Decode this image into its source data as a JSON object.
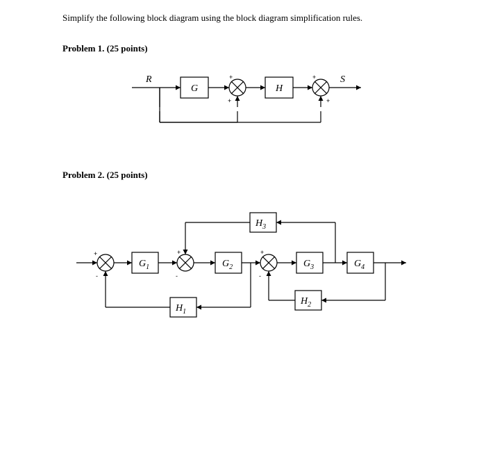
{
  "intro": "Simplify the following block diagram using the block diagram simplification rules.",
  "problem1": {
    "heading": "Problem 1. (25 points)",
    "labels": {
      "R": "R",
      "S": "S",
      "G": "G",
      "H": "H"
    },
    "signs": {
      "sum1_top": "+",
      "sum1_bot": "+",
      "sum2_top": "+",
      "sum2_bot": "+"
    }
  },
  "problem2": {
    "heading": "Problem 2. (25 points)",
    "labels": {
      "G1": "G",
      "G1s": "1",
      "G2": "G",
      "G2s": "2",
      "G3": "G",
      "G3s": "3",
      "G4": "G",
      "G4s": "4",
      "H1": "H",
      "H1s": "1",
      "H2": "H",
      "H2s": "2",
      "H3": "H",
      "H3s": "3"
    },
    "signs": {
      "s1_left": "+",
      "s1_bot": "-",
      "s2_top": "+",
      "s2_bot": "-",
      "s3_top": "+",
      "s3_bot": "-"
    }
  }
}
